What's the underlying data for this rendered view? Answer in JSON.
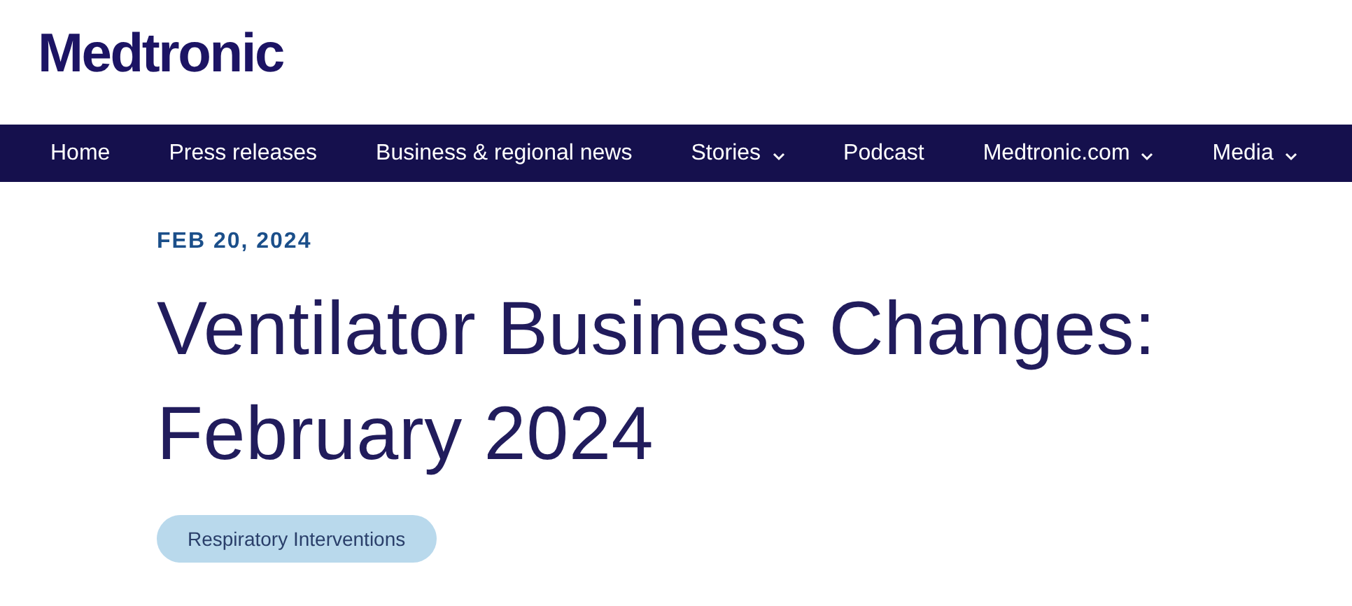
{
  "logo": {
    "text": "Medtronic"
  },
  "nav": [
    {
      "label": "Home",
      "dropdown": false
    },
    {
      "label": "Press releases",
      "dropdown": false
    },
    {
      "label": "Business & regional news",
      "dropdown": false
    },
    {
      "label": "Stories",
      "dropdown": true
    },
    {
      "label": "Podcast",
      "dropdown": false
    },
    {
      "label": "Medtronic.com",
      "dropdown": true
    },
    {
      "label": "Media",
      "dropdown": true
    }
  ],
  "article": {
    "date": "FEB 20, 2024",
    "title": "Ventilator Business Changes: February 2024",
    "tags": [
      "Respiratory Interventions"
    ]
  }
}
